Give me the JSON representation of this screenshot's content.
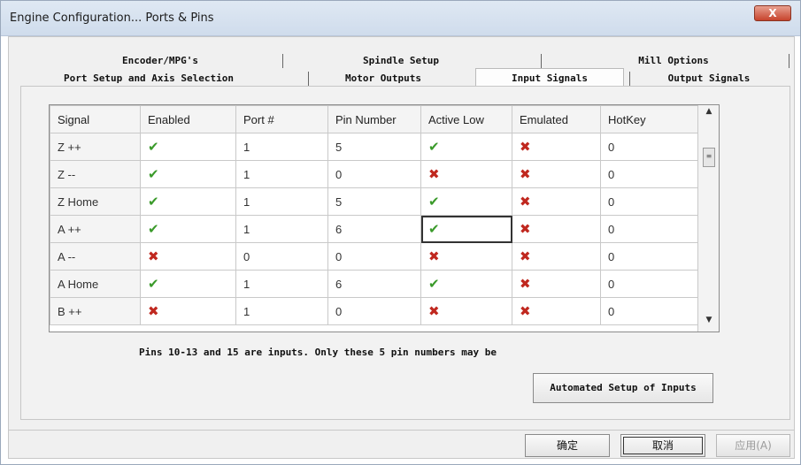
{
  "window": {
    "title": "Engine Configuration... Ports & Pins",
    "close_label": "X"
  },
  "tabs_row1": [
    "Encoder/MPG's",
    "Spindle Setup",
    "Mill Options"
  ],
  "tabs_row2": [
    "Port Setup and Axis Selection",
    "Motor Outputs",
    "Input Signals",
    "Output Signals"
  ],
  "active_tab": "Input Signals",
  "grid": {
    "columns": [
      "Signal",
      "Enabled",
      "Port #",
      "Pin Number",
      "Active Low",
      "Emulated",
      "HotKey"
    ],
    "rows": [
      {
        "signal": "Z ++",
        "enabled": "check",
        "port": "1",
        "pin": "5",
        "active_low": "check",
        "emulated": "cross",
        "hotkey": "0"
      },
      {
        "signal": "Z --",
        "enabled": "check",
        "port": "1",
        "pin": "0",
        "active_low": "cross",
        "emulated": "cross",
        "hotkey": "0"
      },
      {
        "signal": "Z Home",
        "enabled": "check",
        "port": "1",
        "pin": "5",
        "active_low": "check",
        "emulated": "cross",
        "hotkey": "0"
      },
      {
        "signal": "A ++",
        "enabled": "check",
        "port": "1",
        "pin": "6",
        "active_low": "check",
        "emulated": "cross",
        "hotkey": "0"
      },
      {
        "signal": "A --",
        "enabled": "cross",
        "port": "0",
        "pin": "0",
        "active_low": "cross",
        "emulated": "cross",
        "hotkey": "0"
      },
      {
        "signal": "A Home",
        "enabled": "check",
        "port": "1",
        "pin": "6",
        "active_low": "check",
        "emulated": "cross",
        "hotkey": "0"
      },
      {
        "signal": "B ++",
        "enabled": "cross",
        "port": "1",
        "pin": "0",
        "active_low": "cross",
        "emulated": "cross",
        "hotkey": "0"
      }
    ],
    "icon_names": {
      "check": "green-check-icon",
      "cross": "red-x-icon"
    },
    "check_glyph": "✔",
    "cross_glyph": "✖"
  },
  "info_text": "Pins 10-13 and 15 are inputs. Only these 5 pin numbers may be",
  "auto_setup_label": "Automated Setup of Inputs",
  "buttons": {
    "ok": "确定",
    "cancel": "取消",
    "apply": "应用(A)"
  },
  "colors": {
    "check": "#3a9a2a",
    "cross": "#c0281f",
    "titlebar": "#cfdcec",
    "close": "#c7432c"
  }
}
